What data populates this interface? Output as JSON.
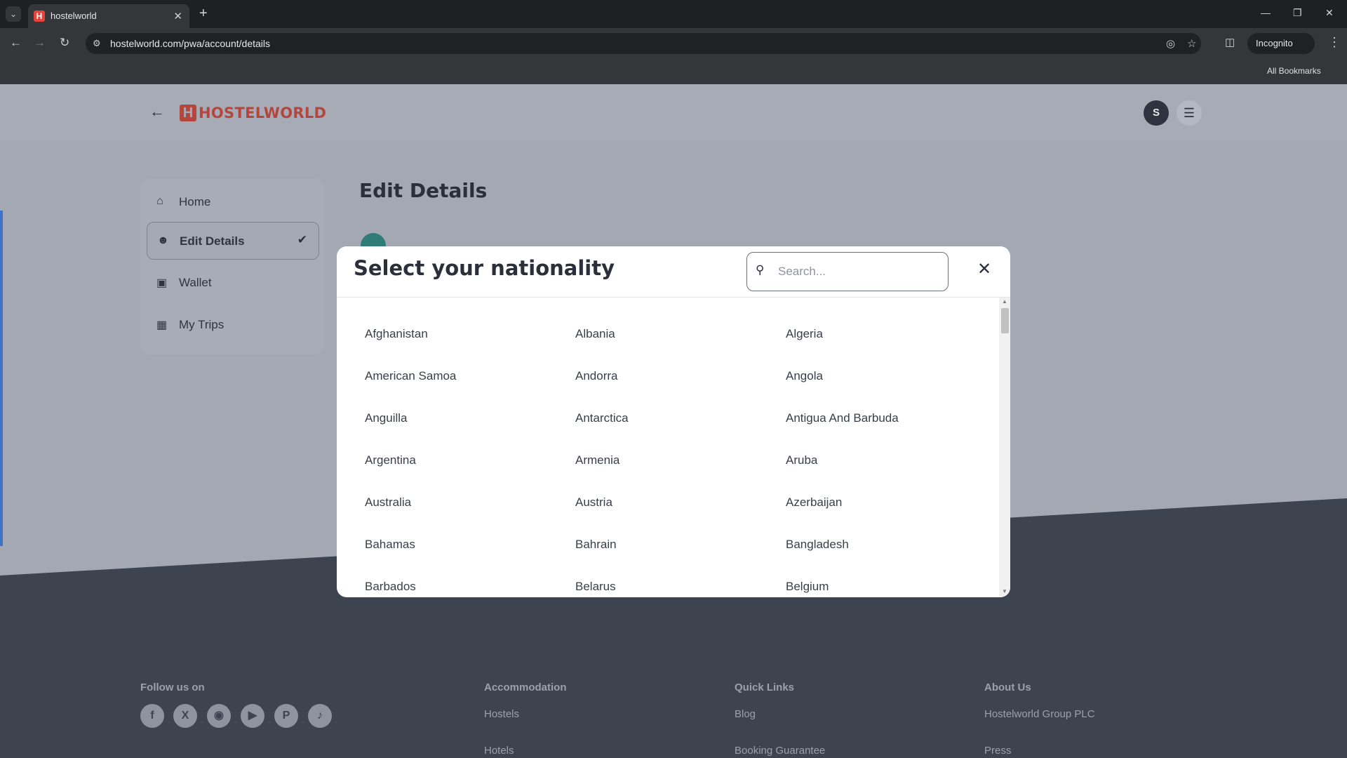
{
  "browser": {
    "tab_title": "hostelworld",
    "url": "hostelworld.com/pwa/account/details",
    "incognito_label": "Incognito",
    "bookmarks_label": "All Bookmarks"
  },
  "header": {
    "logo_mark": "H",
    "logo_text": "HOSTELWORLD",
    "avatar_initial": "S"
  },
  "sidebar": {
    "items": [
      {
        "label": "Home",
        "icon": "home-icon"
      },
      {
        "label": "Edit Details",
        "icon": "user-icon",
        "active": true
      },
      {
        "label": "Wallet",
        "icon": "wallet-icon"
      },
      {
        "label": "My Trips",
        "icon": "map-icon"
      }
    ]
  },
  "main": {
    "title": "Edit Details"
  },
  "modal": {
    "title": "Select your nationality",
    "search_placeholder": "Search...",
    "countries": [
      "Afghanistan",
      "Albania",
      "Algeria",
      "American Samoa",
      "Andorra",
      "Angola",
      "Anguilla",
      "Antarctica",
      "Antigua And Barbuda",
      "Argentina",
      "Armenia",
      "Aruba",
      "Australia",
      "Austria",
      "Azerbaijan",
      "Bahamas",
      "Bahrain",
      "Bangladesh",
      "Barbados",
      "Belarus",
      "Belgium"
    ]
  },
  "footer": {
    "follow_heading": "Follow us on",
    "social": [
      "facebook-icon",
      "x-icon",
      "instagram-icon",
      "youtube-icon",
      "pinterest-icon",
      "tiktok-icon"
    ],
    "columns": [
      {
        "heading": "Accommodation",
        "links": [
          "Hostels",
          "Hotels"
        ]
      },
      {
        "heading": "Quick Links",
        "links": [
          "Blog",
          "Booking Guarantee"
        ]
      },
      {
        "heading": "About Us",
        "links": [
          "Hostelworld Group PLC",
          "Press"
        ]
      }
    ]
  },
  "colors": {
    "brand": "#e8433a",
    "overlay_page": "#a3a8b3",
    "footer": "#3e4350"
  }
}
